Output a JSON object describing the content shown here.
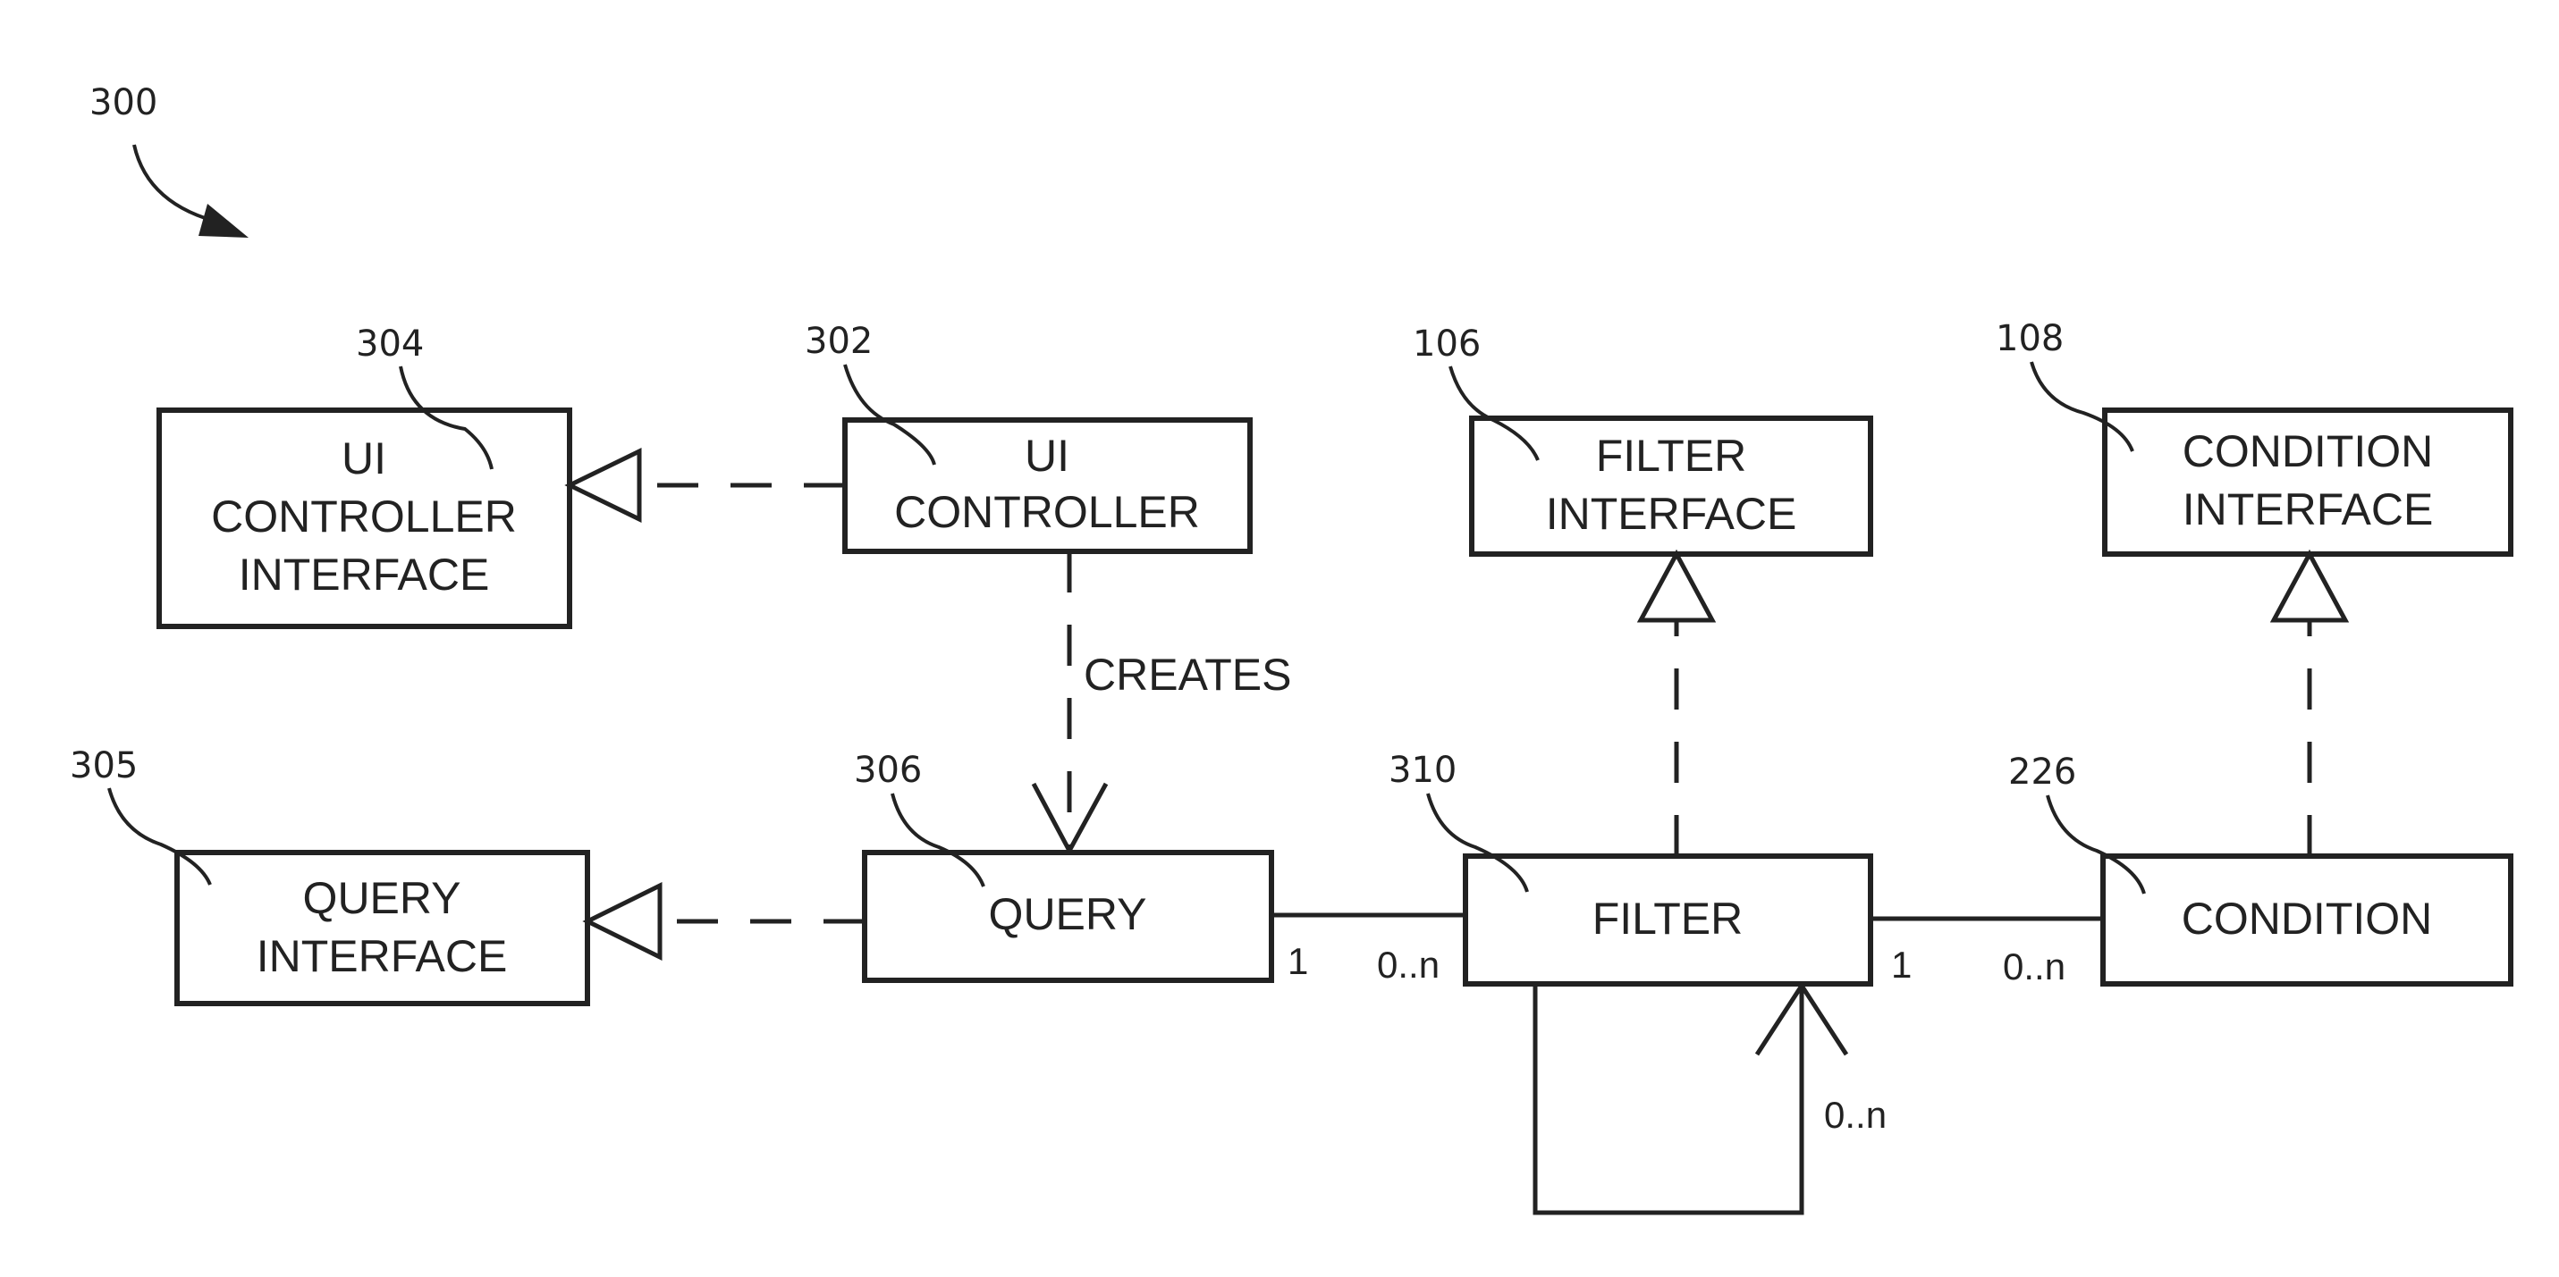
{
  "figure": {
    "reference": "300",
    "nodes": [
      {
        "id": "304",
        "lines": [
          "UI",
          "CONTROLLER",
          "INTERFACE"
        ]
      },
      {
        "id": "302",
        "lines": [
          "UI",
          "CONTROLLER"
        ]
      },
      {
        "id": "106",
        "lines": [
          "FILTER",
          "INTERFACE"
        ]
      },
      {
        "id": "108",
        "lines": [
          "CONDITION",
          "INTERFACE"
        ]
      },
      {
        "id": "305",
        "lines": [
          "QUERY",
          "INTERFACE"
        ]
      },
      {
        "id": "306",
        "lines": [
          "QUERY"
        ]
      },
      {
        "id": "310",
        "lines": [
          "FILTER"
        ]
      },
      {
        "id": "226",
        "lines": [
          "CONDITION"
        ]
      }
    ],
    "edges": {
      "creates_label": "CREATES",
      "query_filter": {
        "source_mult": "1",
        "target_mult": "0..n"
      },
      "filter_condition": {
        "source_mult": "1",
        "target_mult": "0..n"
      },
      "filter_self": {
        "mult": "0..n"
      }
    }
  }
}
